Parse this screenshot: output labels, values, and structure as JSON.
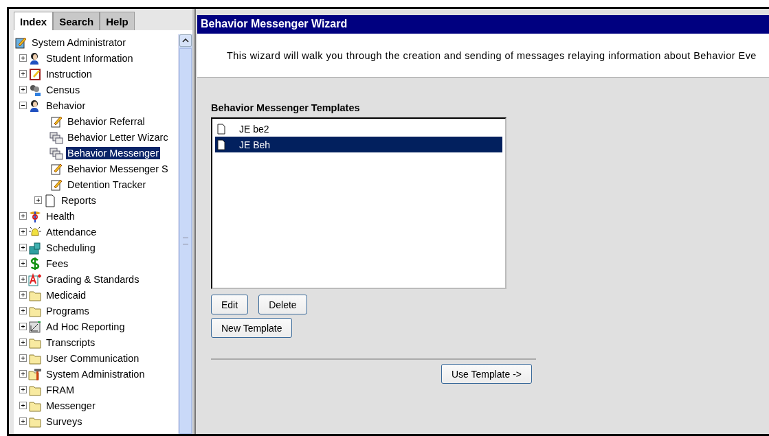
{
  "sidebar": {
    "tabs": [
      {
        "label": "Index",
        "selected": true
      },
      {
        "label": "Search",
        "selected": false
      },
      {
        "label": "Help",
        "selected": false
      }
    ],
    "tree": [
      {
        "label": "System Administrator",
        "kind": "clipboard",
        "selected": false,
        "children": [
          {
            "label": "Student Information",
            "kind": "person",
            "selected": false,
            "expanded": false
          },
          {
            "label": "Instruction",
            "kind": "notebook",
            "selected": false,
            "expanded": false
          },
          {
            "label": "Census",
            "kind": "census",
            "selected": false,
            "expanded": false
          },
          {
            "label": "Behavior",
            "kind": "behavior",
            "selected": false,
            "expanded": true,
            "children": [
              {
                "label": "Behavior Referral",
                "kind": "form",
                "selected": false
              },
              {
                "label": "Behavior Letter Wizarc",
                "kind": "windows",
                "selected": false
              },
              {
                "label": "Behavior Messenger",
                "kind": "windows",
                "selected": true
              },
              {
                "label": "Behavior Messenger S",
                "kind": "form",
                "selected": false
              },
              {
                "label": "Detention Tracker",
                "kind": "form",
                "selected": false
              },
              {
                "label": "Reports",
                "kind": "page",
                "selected": false,
                "expanded": false
              }
            ]
          },
          {
            "label": "Health",
            "kind": "health",
            "selected": false,
            "expanded": false
          },
          {
            "label": "Attendance",
            "kind": "bell",
            "selected": false,
            "expanded": false
          },
          {
            "label": "Scheduling",
            "kind": "building",
            "selected": false,
            "expanded": false
          },
          {
            "label": "Fees",
            "kind": "dollar",
            "selected": false,
            "expanded": false
          },
          {
            "label": "Grading & Standards",
            "kind": "grade",
            "selected": false,
            "expanded": false
          },
          {
            "label": "Medicaid",
            "kind": "folder",
            "selected": false,
            "expanded": false
          },
          {
            "label": "Programs",
            "kind": "folder",
            "selected": false,
            "expanded": false
          },
          {
            "label": "Ad Hoc Reporting",
            "kind": "adhoc",
            "selected": false,
            "expanded": false
          },
          {
            "label": "Transcripts",
            "kind": "folder",
            "selected": false,
            "expanded": false
          },
          {
            "label": "User Communication",
            "kind": "folder",
            "selected": false,
            "expanded": false
          },
          {
            "label": "System Administration",
            "kind": "tools",
            "selected": false,
            "expanded": false
          },
          {
            "label": "FRAM",
            "kind": "folder",
            "selected": false,
            "expanded": false
          },
          {
            "label": "Messenger",
            "kind": "folder",
            "selected": false,
            "expanded": false
          },
          {
            "label": "Surveys",
            "kind": "folder",
            "selected": false,
            "expanded": false
          }
        ]
      }
    ]
  },
  "wizard": {
    "title": "Behavior Messenger Wizard",
    "description": "This wizard will walk you through the creation and sending of messages relaying information about Behavior Eve",
    "templates_label": "Behavior Messenger Templates",
    "templates": [
      {
        "name": "JE be2",
        "selected": false
      },
      {
        "name": "JE Beh",
        "selected": true
      }
    ],
    "buttons": [
      "Edit",
      "Delete"
    ],
    "new_button": "New Template",
    "use_button": "Use Template ->"
  }
}
